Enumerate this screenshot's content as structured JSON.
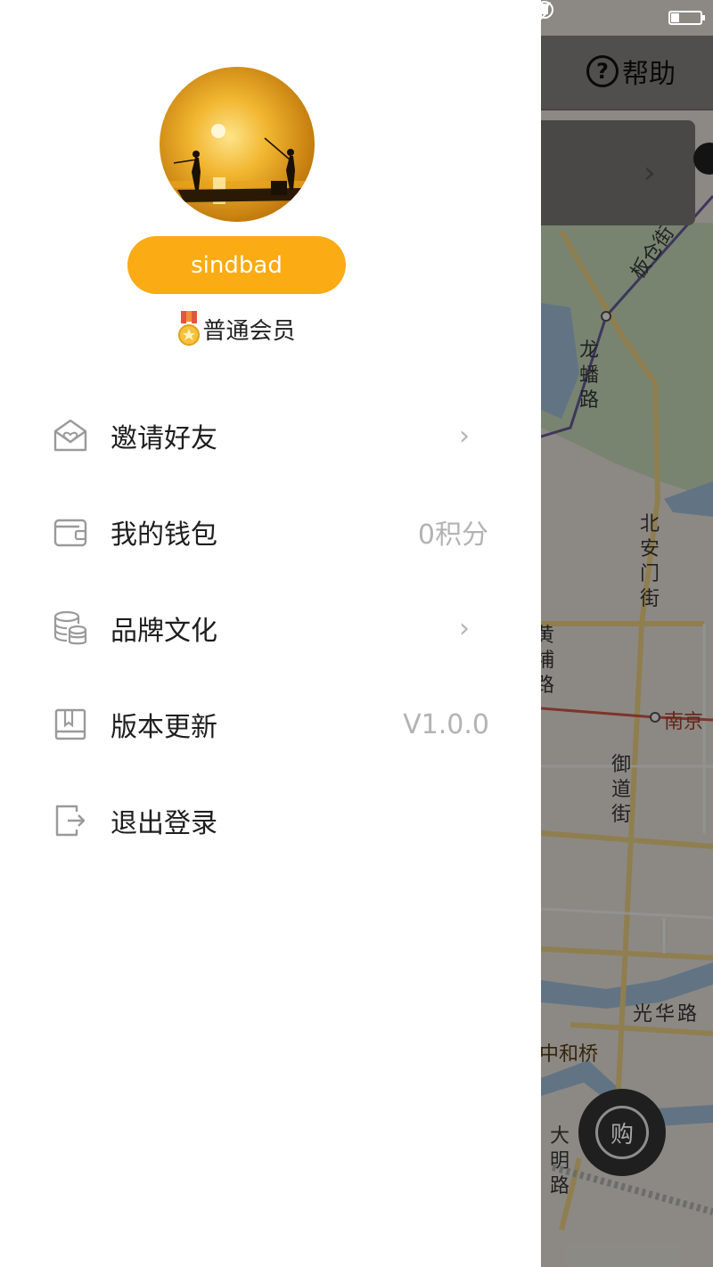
{
  "status_bar": {
    "icons": [
      "rotation-lock-icon",
      "location-arrow-icon",
      "bluetooth-icon",
      "battery-icon"
    ]
  },
  "map_screen": {
    "help_label": "帮助",
    "help_icon_glyph": "?",
    "buy_button_label": "购",
    "streets": {
      "bancang": "板仓街",
      "longpan": "龙蟠路",
      "beianmen": "北安门街",
      "huangpu": "黄埔路",
      "nanjing": "南京",
      "yudao": "御道街",
      "guanghua": "光华路",
      "zhonghe": "中和桥",
      "daming": "大明路"
    }
  },
  "drawer": {
    "profile": {
      "username": "sindbad",
      "membership": "普通会员"
    },
    "menu": [
      {
        "id": "invite",
        "label": "邀请好友",
        "icon": "invite-envelope-icon",
        "right": "chevron"
      },
      {
        "id": "wallet",
        "label": "我的钱包",
        "icon": "wallet-icon",
        "value": "0积分"
      },
      {
        "id": "brand",
        "label": "品牌文化",
        "icon": "database-stack-icon",
        "right": "chevron"
      },
      {
        "id": "version",
        "label": "版本更新",
        "icon": "book-icon",
        "value": "V1.0.0"
      },
      {
        "id": "logout",
        "label": "退出登录",
        "icon": "logout-icon"
      }
    ]
  },
  "colors": {
    "accent": "#fbab13",
    "overlay": "rgba(0,0,0,0.42)"
  }
}
